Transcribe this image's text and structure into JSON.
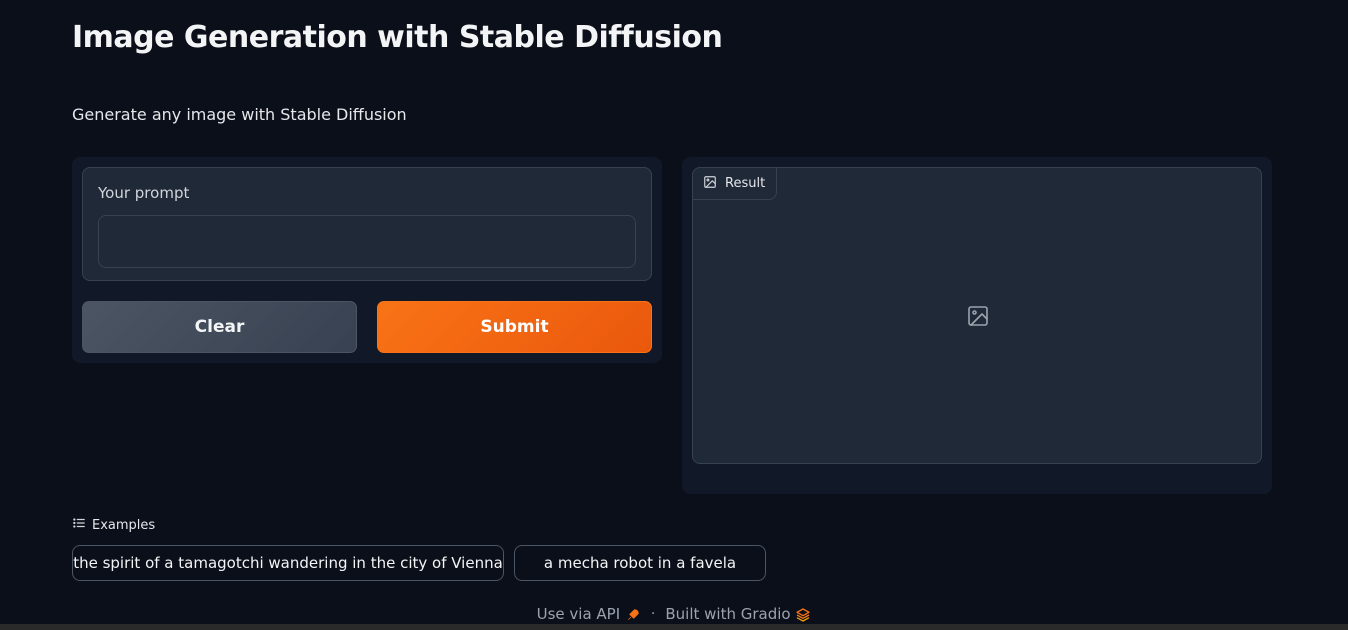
{
  "header": {
    "title": "Image Generation with Stable Diffusion",
    "description": "Generate any image with Stable Diffusion"
  },
  "prompt": {
    "label": "Your prompt",
    "value": "",
    "placeholder": ""
  },
  "buttons": {
    "clear_label": "Clear",
    "submit_label": "Submit"
  },
  "result": {
    "label": "Result",
    "placeholder_icon": "image-icon"
  },
  "examples": {
    "header": "Examples",
    "items": [
      "the spirit of a tamagotchi wandering in the city of Vienna",
      "a mecha robot in a favela"
    ]
  },
  "footer": {
    "api_link": "Use via API",
    "separator": "·",
    "built_with": "Built with Gradio"
  },
  "colors": {
    "background": "#0b0f19",
    "panel": "#111827",
    "block": "#1f2937",
    "accent": "#f97316",
    "secondary_button": "#4b5563"
  }
}
